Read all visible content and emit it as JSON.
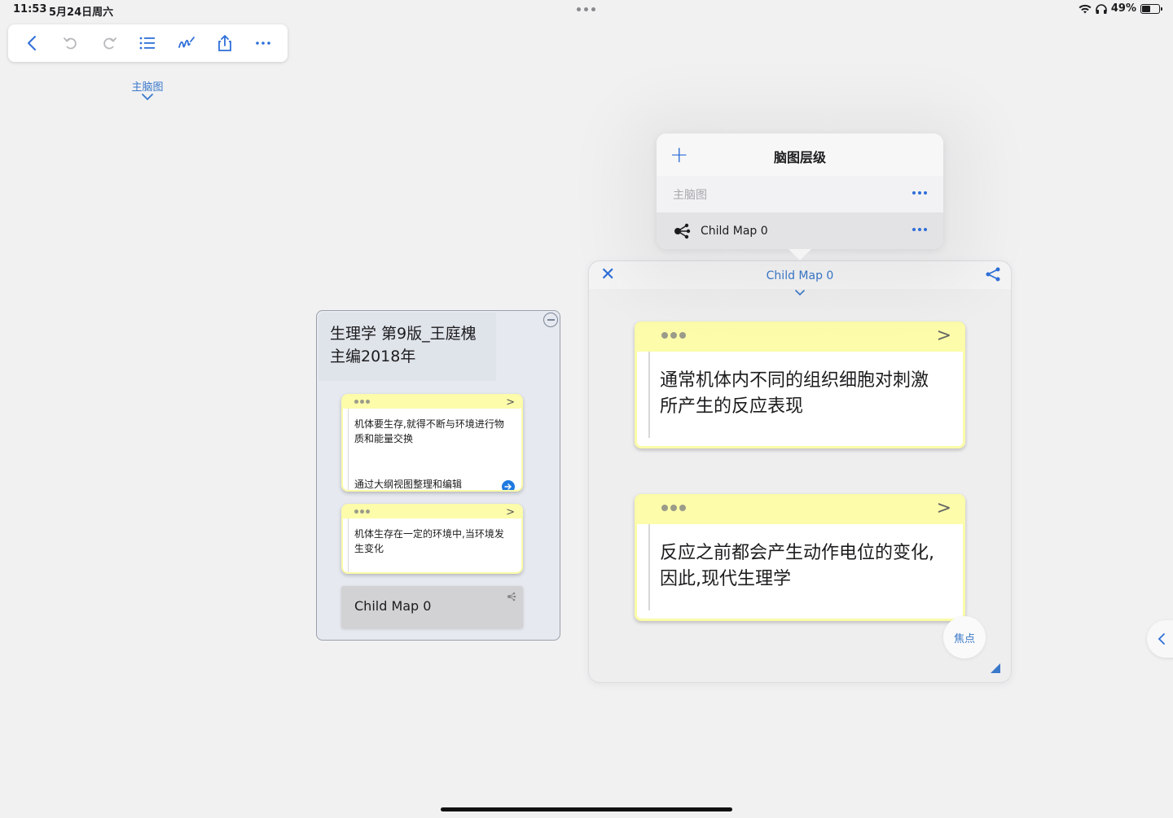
{
  "status_bar": {
    "time": "11:53",
    "date": "5月24日周六",
    "battery": "49%",
    "battery_level": 0.49
  },
  "toolbar": {
    "icons": [
      "back-icon",
      "undo-icon",
      "redo-icon",
      "outline-list-icon",
      "pen-icon",
      "share-icon",
      "more-icon"
    ]
  },
  "breadcrumb": {
    "label": "主脑图"
  },
  "left_map": {
    "title": "生理学 第9版_王庭槐主编2018年",
    "notes": [
      {
        "text": "机体要生存,就得不断与环境进行物质和能量交换",
        "link_text": "通过大纲视图整理和编辑"
      },
      {
        "text": "机体生存在一定的环境中,当环境发生变化"
      }
    ],
    "child_map_label": "Child Map 0"
  },
  "popover": {
    "title": "脑图层级",
    "rows": [
      {
        "label": "主脑图"
      },
      {
        "label": "Child Map 0"
      }
    ]
  },
  "right_panel": {
    "title": "Child Map 0",
    "notes": [
      {
        "text": "通常机体内不同的组织细胞对刺激所产生的反应表现"
      },
      {
        "text": "反应之前都会产生动作电位的变化,因此,现代生理学"
      }
    ],
    "focus_label": "焦点"
  },
  "colors": {
    "accent": "#2e6fd8",
    "note_header": "#fcfcaa",
    "background": "#f1f1f2"
  }
}
